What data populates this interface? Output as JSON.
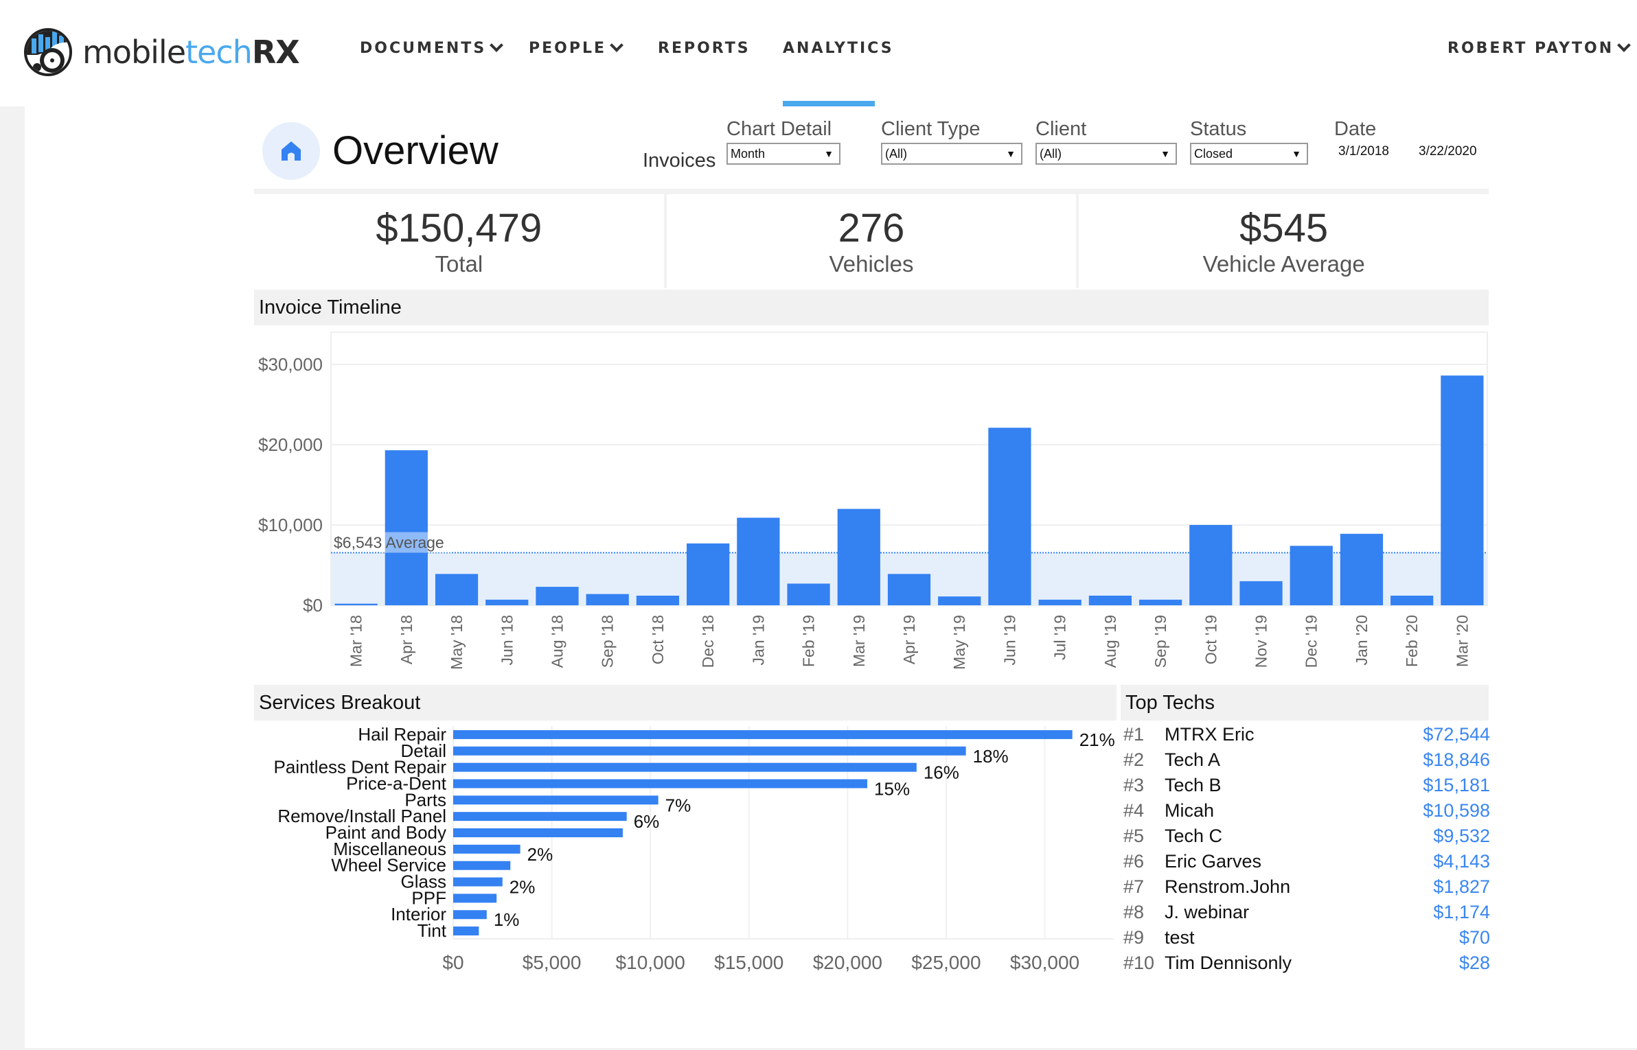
{
  "brand": {
    "part1": "mobile",
    "part2": "tech",
    "part3": "RX"
  },
  "nav": {
    "items": [
      {
        "label": "DOCUMENTS",
        "has_dropdown": true
      },
      {
        "label": "PEOPLE",
        "has_dropdown": true
      },
      {
        "label": "REPORTS",
        "has_dropdown": false
      },
      {
        "label": "ANALYTICS",
        "has_dropdown": false,
        "active": true
      }
    ],
    "user": "ROBERT PAYTON",
    "accent_color": "#4aa8ee"
  },
  "page": {
    "title": "Overview",
    "icon": "home-icon"
  },
  "filters": {
    "invoices_label": "Invoices",
    "chart_detail": {
      "label": "Chart Detail",
      "value": "Month"
    },
    "client_type": {
      "label": "Client Type",
      "value": "(All)"
    },
    "client": {
      "label": "Client",
      "value": "(All)"
    },
    "status": {
      "label": "Status",
      "value": "Closed"
    },
    "date": {
      "label": "Date",
      "start": "3/1/2018",
      "end": "3/22/2020"
    }
  },
  "kpis": [
    {
      "value": "$150,479",
      "caption": "Total"
    },
    {
      "value": "276",
      "caption": "Vehicles"
    },
    {
      "value": "$545",
      "caption": "Vehicle Average"
    }
  ],
  "sections": {
    "timeline": "Invoice Timeline",
    "services": "Services Breakout",
    "techs": "Top Techs"
  },
  "chart_data": [
    {
      "type": "bar",
      "title": "Invoice Timeline",
      "categories": [
        "Mar '18",
        "Apr '18",
        "May '18",
        "Jun '18",
        "Aug '18",
        "Sep '18",
        "Oct '18",
        "Dec '18",
        "Jan '19",
        "Feb '19",
        "Mar '19",
        "Apr '19",
        "May '19",
        "Jun '19",
        "Jul '19",
        "Aug '19",
        "Sep '19",
        "Oct '19",
        "Nov '19",
        "Dec '19",
        "Jan '20",
        "Feb '20",
        "Mar '20"
      ],
      "values": [
        200,
        19300,
        3900,
        700,
        2300,
        1400,
        1200,
        7700,
        10900,
        2700,
        12000,
        3900,
        1100,
        22100,
        700,
        1200,
        700,
        10000,
        3000,
        7400,
        8900,
        1200,
        28600
      ],
      "yticks": [
        0,
        10000,
        20000,
        30000
      ],
      "ytick_labels": [
        "$0",
        "$10,000",
        "$20,000",
        "$30,000"
      ],
      "ylim": [
        0,
        34000
      ],
      "average": 6543,
      "average_label": "$6,543 Average",
      "xlabel": "",
      "ylabel": "",
      "bar_color": "#3481f2",
      "grid": true
    },
    {
      "type": "bar",
      "orientation": "horizontal",
      "title": "Services Breakout",
      "categories": [
        "Hail Repair",
        "Detail",
        "Paintless Dent Repair",
        "Price-a-Dent",
        "Parts",
        "Remove/Install Panel",
        "Paint and Body",
        "Miscellaneous",
        "Wheel Service",
        "Glass",
        "PPF",
        "Interior",
        "Tint"
      ],
      "values": [
        31400,
        26000,
        23500,
        21000,
        10400,
        8800,
        8600,
        3400,
        2900,
        2500,
        2200,
        1700,
        1300
      ],
      "data_labels": [
        "21%",
        "18%",
        "16%",
        "15%",
        "7%",
        "6%",
        "",
        "2%",
        "",
        "2%",
        "",
        "1%",
        ""
      ],
      "xticks": [
        0,
        5000,
        10000,
        15000,
        20000,
        25000,
        30000
      ],
      "xtick_labels": [
        "$0",
        "$5,000",
        "$10,000",
        "$15,000",
        "$20,000",
        "$25,000",
        "$30,000"
      ],
      "xlim": [
        0,
        33500
      ],
      "bar_color": "#3481f2",
      "grid": true
    }
  ],
  "top_techs": [
    {
      "rank": "#1",
      "name": "MTRX Eric",
      "amount": "$72,544"
    },
    {
      "rank": "#2",
      "name": "Tech A",
      "amount": "$18,846"
    },
    {
      "rank": "#3",
      "name": "Tech B",
      "amount": "$15,181"
    },
    {
      "rank": "#4",
      "name": "Micah",
      "amount": "$10,598"
    },
    {
      "rank": "#5",
      "name": "Tech C",
      "amount": "$9,532"
    },
    {
      "rank": "#6",
      "name": "Eric Garves",
      "amount": "$4,143"
    },
    {
      "rank": "#7",
      "name": "Renstrom.John",
      "amount": "$1,827"
    },
    {
      "rank": "#8",
      "name": "J. webinar",
      "amount": "$1,174"
    },
    {
      "rank": "#9",
      "name": "test",
      "amount": "$70"
    },
    {
      "rank": "#10",
      "name": "Tim Dennisonly",
      "amount": "$28"
    }
  ]
}
